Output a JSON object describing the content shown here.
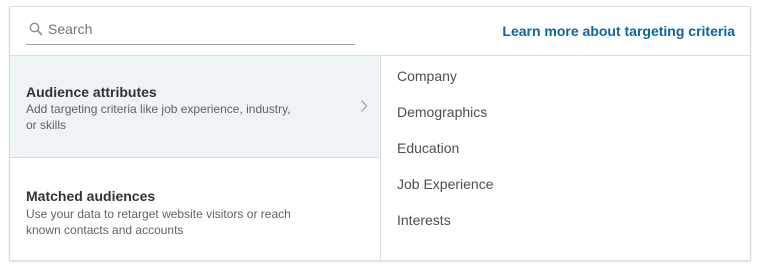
{
  "search": {
    "placeholder": "Search",
    "value": ""
  },
  "header": {
    "learn_more_link": "Learn more about targeting criteria"
  },
  "options": [
    {
      "title": "Audience attributes",
      "description": "Add targeting criteria like job experience, industry, or skills",
      "selected": true
    },
    {
      "title": "Matched audiences",
      "description": "Use your data to retarget website visitors or reach known contacts and accounts",
      "selected": false
    }
  ],
  "categories": [
    "Company",
    "Demographics",
    "Education",
    "Job Experience",
    "Interests"
  ],
  "icons": {
    "search": "search-icon",
    "chevron": "chevron-right-icon"
  },
  "colors": {
    "link": "#0a66a2",
    "selected_background": "#eef3f6",
    "border": "#d9dcdf"
  }
}
